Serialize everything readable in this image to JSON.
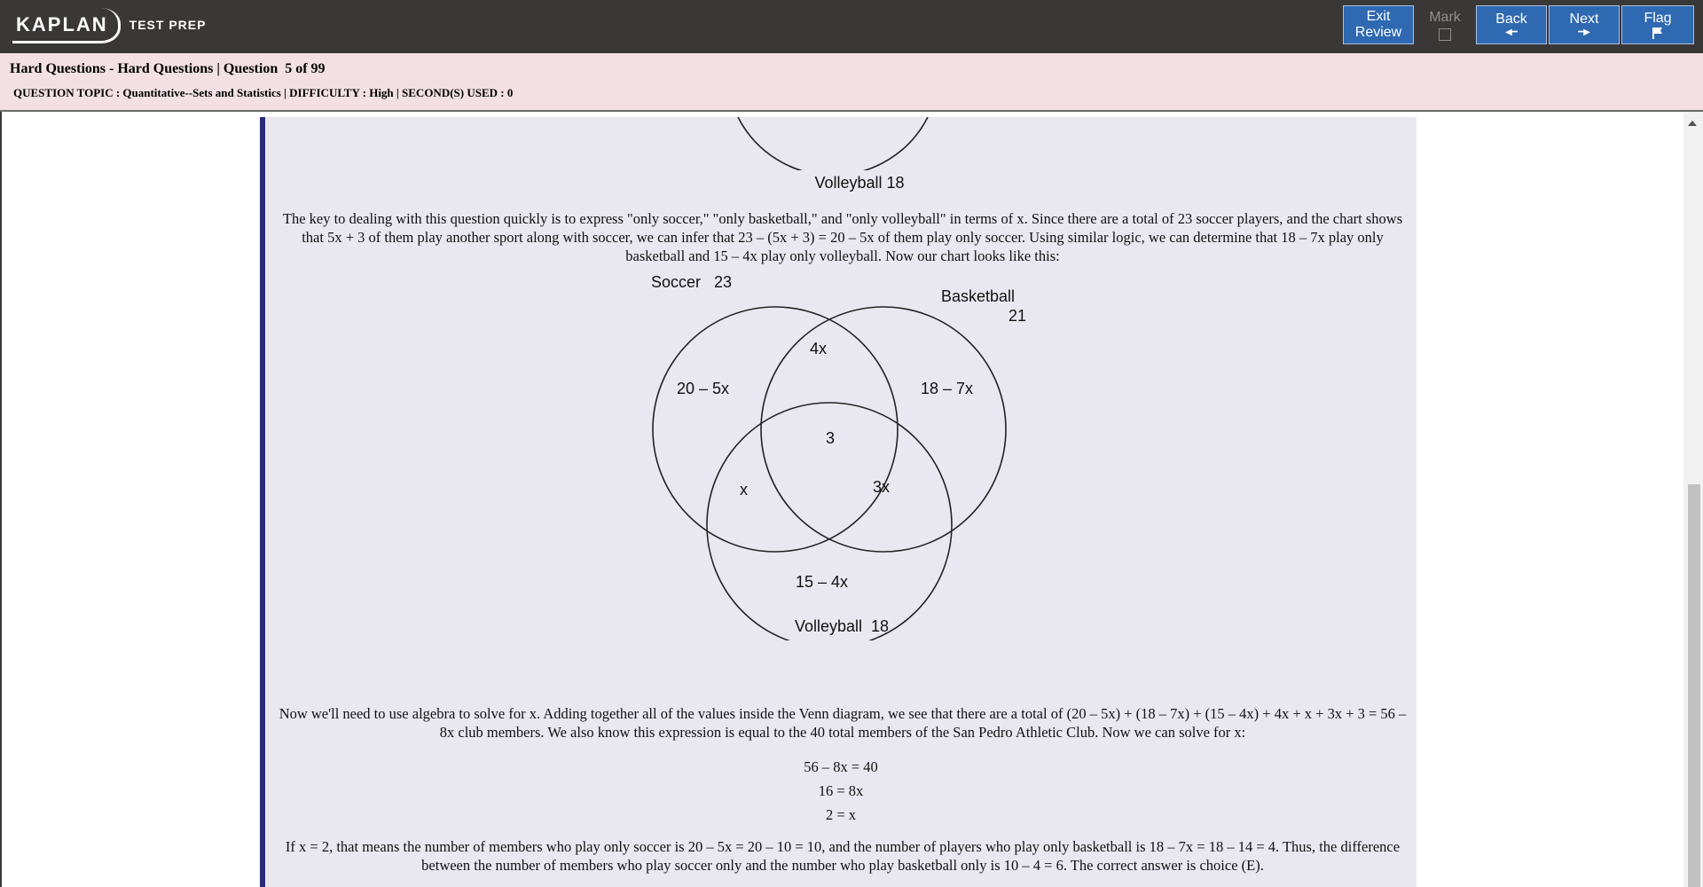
{
  "brand": {
    "name": "KAPLAN",
    "sub": "TEST PREP"
  },
  "toolbar": {
    "exit_review_line1": "Exit",
    "exit_review_line2": "Review",
    "mark_label": "Mark",
    "back_label": "Back",
    "next_label": "Next",
    "flag_label": "Flag"
  },
  "header": {
    "title": "Hard Questions - Hard Questions | Question  5 of 99",
    "meta": "QUESTION TOPIC : Quantitative--Sets and Statistics | DIFFICULTY : High | SECOND(S) USED : 0"
  },
  "content": {
    "top_diagram_label": "Volleyball  18",
    "para1": "The key to dealing with this question quickly is to express \"only soccer,\" \"only basketball,\" and \"only volleyball\" in terms of x. Since there are a total of 23 soccer players, and the chart shows that 5x + 3 of them play another sport along with soccer, we can infer that 23 – (5x + 3) = 20 – 5x of them play only soccer. Using similar logic, we can determine that 18 – 7x play only basketball and 15 – 4x play only volleyball. Now our chart looks like this:",
    "venn": {
      "soccer_label": "Soccer   23",
      "basketball_label": "Basketball",
      "basketball_count": "21",
      "volleyball_label": "Volleyball  18",
      "only_soccer": "20 – 5x",
      "only_basketball": "18 – 7x",
      "only_volleyball": "15 – 4x",
      "soccer_basketball": "4x",
      "soccer_volleyball": "x",
      "basketball_volleyball": "3x",
      "all_three": "3"
    },
    "para2": "Now we'll need to use algebra to solve for x. Adding together all of the values inside the Venn diagram, we see that there are a total of (20 – 5x) + (18 – 7x) + (15 – 4x) + 4x + x + 3x + 3 = 56 – 8x club members. We also know this expression is equal to the 40 total members of the San Pedro Athletic Club. Now we can solve for x:",
    "eq1": "56 – 8x = 40",
    "eq2": "16 = 8x",
    "eq3": "2 = x",
    "para3": "If x = 2, that means the number of members who play only soccer is 20 – 5x = 20 – 10 = 10, and the number of players who play only basketball is 18 – 7x = 18 – 14 = 4. Thus, the difference between the number of members who play soccer only and the number who play basketball only is 10 – 4 = 6. The correct answer is choice (E)."
  }
}
